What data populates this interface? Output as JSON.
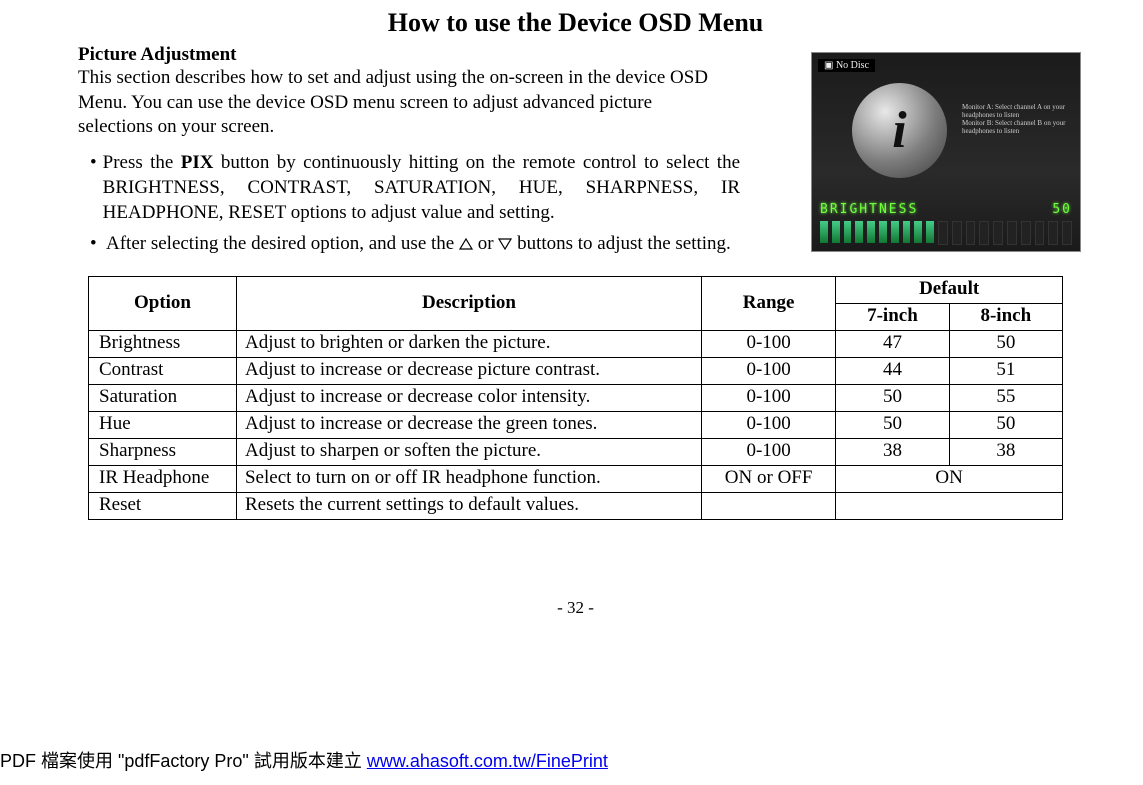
{
  "title": "How to use the Device OSD Menu",
  "subhead": "Picture Adjustment",
  "intro": "This section describes how to set and adjust using the on-screen in the device OSD Menu. You can use the device OSD menu screen to adjust advanced picture selections on your screen.",
  "bullets": [
    {
      "pre": "Press the ",
      "bold": "PIX",
      "post": " button by continuously hitting on the remote control to select the BRIGHTNESS, CONTRAST, SATURATION, HUE, SHARPNESS, IR HEADPHONE, RESET options to adjust value and setting."
    },
    {
      "text_a": "After selecting the desired option, and use the ",
      "text_b": " or ",
      "text_c": " buttons to adjust the setting."
    }
  ],
  "illus": {
    "no_disc": "No  Disc",
    "line1": "Monitor A: Select channel A on your headphones to listen",
    "line2": "Monitor B: Select channel B on your headphones to listen",
    "osd_label": "BRIGHTNESS",
    "osd_value": "50"
  },
  "table": {
    "headers": {
      "option": "Option",
      "description": "Description",
      "range": "Range",
      "default": "Default",
      "seven": "7-inch",
      "eight": "8-inch"
    },
    "rows": [
      {
        "option": "Brightness",
        "desc": "Adjust to brighten or darken the picture.",
        "range": "0-100",
        "d7": "47",
        "d8": "50"
      },
      {
        "option": "Contrast",
        "desc": "Adjust to increase or decrease picture contrast.",
        "range": "0-100",
        "d7": "44",
        "d8": "51"
      },
      {
        "option": "Saturation",
        "desc": "Adjust to increase or decrease color intensity.",
        "range": "0-100",
        "d7": "50",
        "d8": "55"
      },
      {
        "option": "Hue",
        "desc": "Adjust to increase or decrease the green tones.",
        "range": "0-100",
        "d7": "50",
        "d8": "50"
      },
      {
        "option": "Sharpness",
        "desc": "Adjust to sharpen or soften the picture.",
        "range": "0-100",
        "d7": "38",
        "d8": "38"
      },
      {
        "option": "IR Headphone",
        "desc": "Select to turn on or off IR headphone function.",
        "range": "ON or OFF",
        "merged": "ON"
      },
      {
        "option": "Reset",
        "desc": "Resets the current settings to default values.",
        "range": "",
        "merged": ""
      }
    ]
  },
  "page_num": "- 32 -",
  "footer": {
    "pre": "PDF 檔案使用 \"pdfFactory Pro\" 試用版本建立 ",
    "link_text": "www.ahasoft.com.tw/FinePrint"
  }
}
